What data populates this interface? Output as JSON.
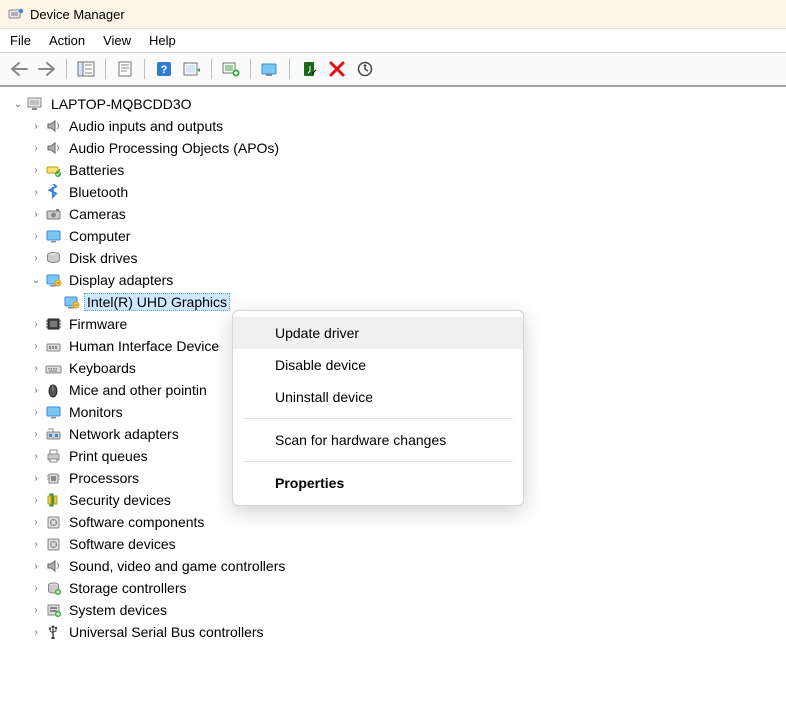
{
  "window": {
    "title": "Device Manager"
  },
  "menu": {
    "file": "File",
    "action": "Action",
    "view": "View",
    "help": "Help"
  },
  "root": {
    "label": "LAPTOP-MQBCDD3O"
  },
  "categories": [
    {
      "label": "Audio inputs and outputs",
      "icon": "speaker",
      "expanded": false
    },
    {
      "label": "Audio Processing Objects (APOs)",
      "icon": "speaker",
      "expanded": false
    },
    {
      "label": "Batteries",
      "icon": "battery",
      "expanded": false
    },
    {
      "label": "Bluetooth",
      "icon": "bluetooth",
      "expanded": false
    },
    {
      "label": "Cameras",
      "icon": "camera",
      "expanded": false
    },
    {
      "label": "Computer",
      "icon": "monitor",
      "expanded": false
    },
    {
      "label": "Disk drives",
      "icon": "disk",
      "expanded": false
    },
    {
      "label": "Display adapters",
      "icon": "display-adapter",
      "expanded": true,
      "children": [
        {
          "label": "Intel(R) UHD Graphics",
          "icon": "display-adapter",
          "selected": true
        }
      ]
    },
    {
      "label": "Firmware",
      "icon": "firmware",
      "expanded": false
    },
    {
      "label": "Human Interface Device",
      "icon": "hid",
      "expanded": false,
      "truncated_label": "Human Interface Device"
    },
    {
      "label": "Keyboards",
      "icon": "keyboard",
      "expanded": false
    },
    {
      "label": "Mice and other pointin",
      "icon": "mouse",
      "expanded": false
    },
    {
      "label": "Monitors",
      "icon": "monitor",
      "expanded": false
    },
    {
      "label": "Network adapters",
      "icon": "network",
      "expanded": false
    },
    {
      "label": "Print queues",
      "icon": "printer",
      "expanded": false
    },
    {
      "label": "Processors",
      "icon": "cpu",
      "expanded": false
    },
    {
      "label": "Security devices",
      "icon": "security",
      "expanded": false
    },
    {
      "label": "Software components",
      "icon": "software",
      "expanded": false
    },
    {
      "label": "Software devices",
      "icon": "software",
      "expanded": false
    },
    {
      "label": "Sound, video and game controllers",
      "icon": "speaker",
      "expanded": false
    },
    {
      "label": "Storage controllers",
      "icon": "storage",
      "expanded": false
    },
    {
      "label": "System devices",
      "icon": "system",
      "expanded": false
    },
    {
      "label": "Universal Serial Bus controllers",
      "icon": "usb",
      "expanded": false
    }
  ],
  "context_menu": {
    "items": [
      {
        "label": "Update driver",
        "hover": true
      },
      {
        "label": "Disable device"
      },
      {
        "label": "Uninstall device"
      },
      {
        "sep": true
      },
      {
        "label": "Scan for hardware changes"
      },
      {
        "sep": true
      },
      {
        "label": "Properties",
        "bold": true
      }
    ]
  }
}
